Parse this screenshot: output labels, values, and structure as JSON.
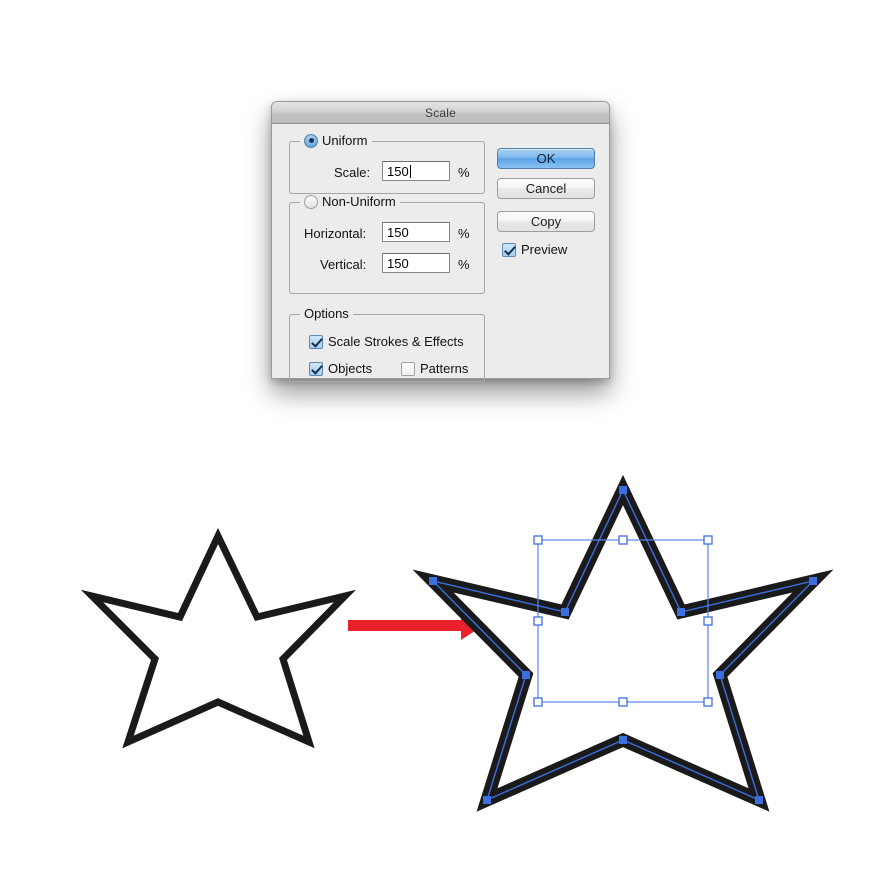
{
  "dialog": {
    "title": "Scale",
    "uniform": {
      "group_label": "Uniform",
      "radio_state": "selected",
      "scale_label": "Scale:",
      "scale_value": "150",
      "scale_unit": "%"
    },
    "non_uniform": {
      "group_label": "Non-Uniform",
      "radio_state": "unselected",
      "horizontal_label": "Horizontal:",
      "horizontal_value": "150",
      "horizontal_unit": "%",
      "vertical_label": "Vertical:",
      "vertical_value": "150",
      "vertical_unit": "%"
    },
    "options": {
      "group_label": "Options",
      "scale_strokes_label": "Scale Strokes & Effects",
      "scale_strokes_checked": true,
      "objects_label": "Objects",
      "objects_checked": true,
      "patterns_label": "Patterns",
      "patterns_checked": false
    },
    "buttons": {
      "ok_label": "OK",
      "cancel_label": "Cancel",
      "copy_label": "Copy",
      "preview_label": "Preview",
      "preview_checked": true
    },
    "colors": {
      "default_button_blue": "#5ba3e6",
      "window_background": "#ececec",
      "selection_blue": "#3b6fe0"
    }
  },
  "illustration": {
    "original_shape": "star-outline",
    "scaled_shape": "star-outline-selected",
    "arrow": "right-arrow",
    "arrow_color": "#e8212a",
    "selection_color": "#3b6fe0",
    "stroke_color": "#1a1a1a"
  }
}
